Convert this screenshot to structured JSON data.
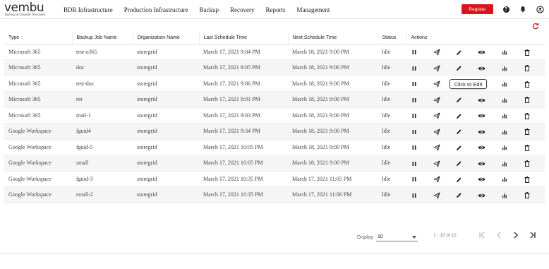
{
  "header": {
    "logo_text": "vembu",
    "logo_tagline": "Backup & Disaster Recovery",
    "nav": [
      {
        "label": "BDR Infrastructure"
      },
      {
        "label": "Production Infrastructure"
      },
      {
        "label": "Backup"
      },
      {
        "label": "Recovery"
      },
      {
        "label": "Reports"
      },
      {
        "label": "Management"
      }
    ],
    "register_label": "Register",
    "help_glyph": "?",
    "icons": [
      "help-icon",
      "bell-icon",
      "user-account-icon"
    ],
    "brand_color": "#d9141e"
  },
  "table": {
    "columns": [
      "Type",
      "Backup Job Name",
      "Organization Name",
      "Last Schedule Time",
      "Next Schedule Time",
      "Status",
      "Actions"
    ],
    "rows": [
      {
        "type": "Microsoft 365",
        "job": "test-o365",
        "org": "storegrid",
        "last": "March 17, 2021 9:04 PM",
        "next": "March 18, 2021 9:00 PM",
        "status": "Idle"
      },
      {
        "type": "Microsoft 365",
        "job": "doc",
        "org": "storegrid",
        "last": "March 17, 2021 9:05 PM",
        "next": "March 18, 2021 9:00 PM",
        "status": "Idle"
      },
      {
        "type": "Microsoft 365",
        "job": "test-doc",
        "org": "storegrid",
        "last": "March 17, 2021 9:06 PM",
        "next": "March 18, 2021 9:00 PM",
        "status": "Idle"
      },
      {
        "type": "Microsoft 365",
        "job": "ret",
        "org": "storegrid",
        "last": "March 17, 2021 9:01 PM",
        "next": "March 18, 2021 9:00 PM",
        "status": "Idle"
      },
      {
        "type": "Microsoft 365",
        "job": "mail-1",
        "org": "storegrid",
        "last": "March 17, 2021 9:03 PM",
        "next": "March 18, 2021 9:00 PM",
        "status": "Idle"
      },
      {
        "type": "Google Workspace",
        "job": "fguid4",
        "org": "storegrid",
        "last": "March 17, 2021 9:34 PM",
        "next": "March 18, 2021 9:00 PM",
        "status": "Idle"
      },
      {
        "type": "Google Workspace",
        "job": "fguid-5",
        "org": "storegrid",
        "last": "March 17, 2021 10:05 PM",
        "next": "March 18, 2021 9:00 PM",
        "status": "Idle"
      },
      {
        "type": "Google Workspace",
        "job": "small",
        "org": "storegrid",
        "last": "March 17, 2021 10:05 PM",
        "next": "March 18, 2021 9:00 PM",
        "status": "Idle"
      },
      {
        "type": "Google Workspace",
        "job": "fguid-3",
        "org": "storegrid",
        "last": "March 17, 2021 10:35 PM",
        "next": "March 17, 2021 11:05 PM",
        "status": "Idle"
      },
      {
        "type": "Google Workspace",
        "job": "small-2",
        "org": "storegrid",
        "last": "March 17, 2021 10:35 PM",
        "next": "March 17, 2021 11:06 PM",
        "status": "Idle"
      }
    ],
    "row_actions": [
      "pause-icon",
      "send-icon",
      "edit-icon",
      "view-icon",
      "stats-icon",
      "delete-icon"
    ],
    "tooltip": "Click to Edit"
  },
  "pagination": {
    "display_label": "Display",
    "page_size": "10",
    "range": "1 - 10 of 12"
  }
}
